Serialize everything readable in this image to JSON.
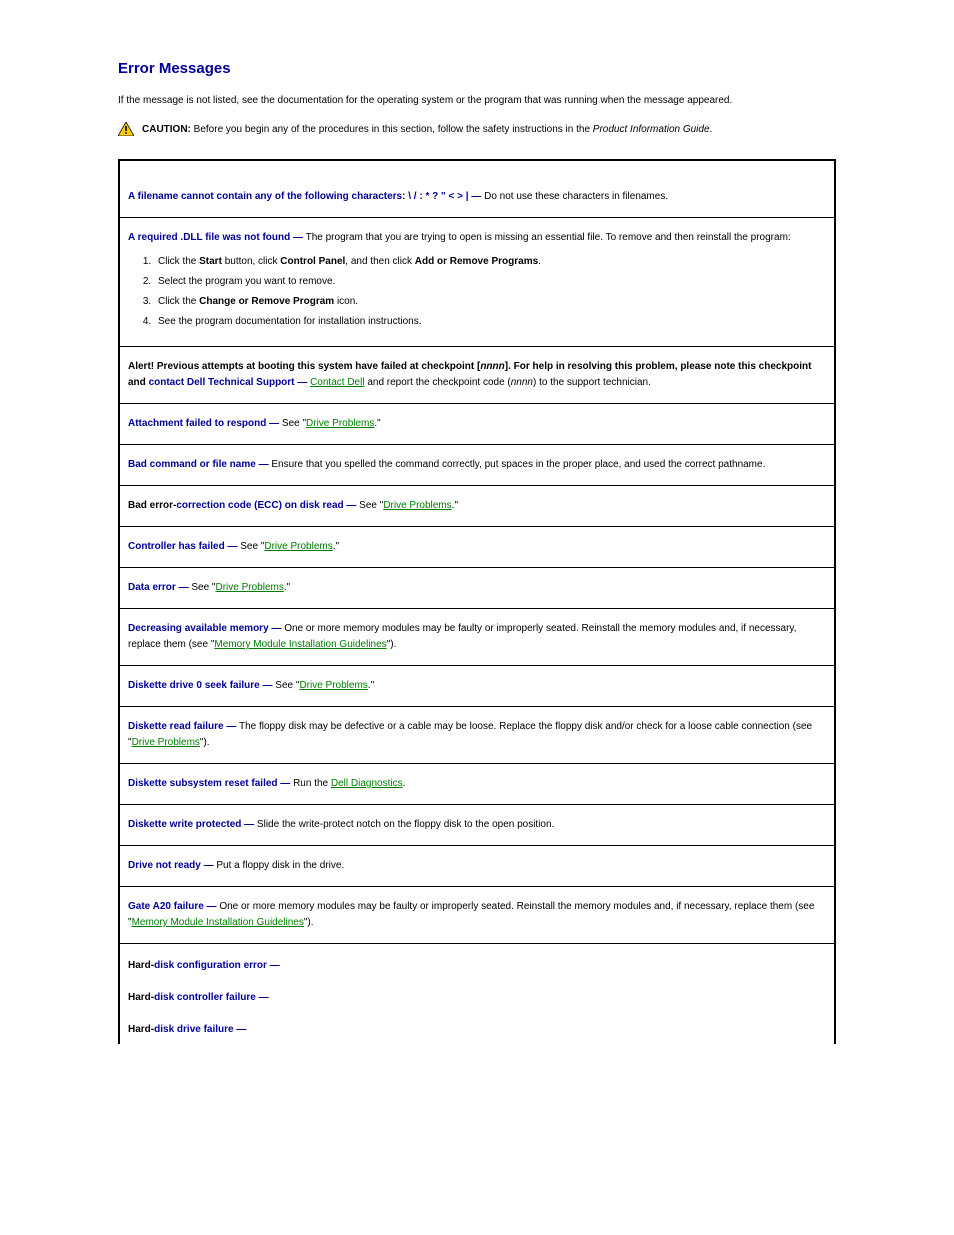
{
  "heading": "Error Messages",
  "intro": "If the message is not listed, see the documentation for the operating system or the program that was running when the message appeared.",
  "caution": {
    "label": "CAUTION:",
    "text_before": "Before you begin any of the procedures in this section, follow the safety instructions in the ",
    "ital": "Product Information Guide",
    "text_after": "."
  },
  "rows": [
    {
      "title": "A filename cannot contain any of the following characters: \\ / : * ? \" < > |  —",
      "body": "  Do not use these characters in filenames."
    },
    {
      "title": "A required .DLL file was not found  —",
      "body": "  The program that you are trying to open is missing an essential file. To remove and then reinstall the program:",
      "list": [
        {
          "text": "Click the ",
          "b1": "Start",
          "t2": " button, click ",
          "b2": "Control Panel",
          "t3": ", and then click ",
          "b3": "Add or Remove Programs",
          "t4": "."
        },
        {
          "text": "Select the program you want to remove."
        },
        {
          "text": "Click the ",
          "b1": "Change or Remove Program",
          "t2": " icon."
        },
        {
          "text": "See the program documentation for installation instructions."
        }
      ]
    },
    {
      "prefixBlack": "Alert! Previous attempts at booting this system have failed at checkpoint [",
      "prefixBlack2": "nnnn",
      "prefixBlack3": "]. For help in resolving this problem, please note this checkpoint and ",
      "title": "contact Dell Technical Support  —",
      "link": "Contact Dell",
      "body2": " and report the checkpoint code (",
      "ital": "nnnn",
      "body3": ") to the support technician."
    },
    {
      "title": "Attachment failed to respond  —",
      "body": "  See \"",
      "link": "Drive Problems",
      "body2": ".\""
    },
    {
      "title": "Bad command or file name  —",
      "body": "  Ensure that you spelled the command correctly, put spaces in the proper place, and used the correct pathname."
    },
    {
      "prefixBlack": "Bad error-",
      "title": "correction code (ECC) on disk read  —",
      "body": "  See \"",
      "link": "Drive Problems",
      "body2": ".\""
    },
    {
      "title": "Controller has failed  —",
      "body": "  See \"",
      "link": "Drive Problems",
      "body2": ".\""
    },
    {
      "title": "Data error  —",
      "body": "  See \"",
      "link": "Drive Problems",
      "body2": ".\""
    },
    {
      "title": "Decreasing available memory  —",
      "body": "  One or more memory modules may be faulty or improperly seated. Reinstall the memory modules and, if necessary, replace them (see \"",
      "link": "Memory Module Installation Guidelines",
      "body2": "\")."
    },
    {
      "title": "Diskette drive 0 seek failure  —",
      "body": "  See \"",
      "link": "Drive Problems",
      "body2": ".\""
    },
    {
      "title": "Diskette read failure  —",
      "body": "  The floppy disk may be defective or a cable may be loose. Replace the floppy disk and/or check for a loose cable connection (see \"",
      "link": "Drive Problems",
      "body2": "\")."
    },
    {
      "title": "Diskette subsystem reset failed  —",
      "body": "  Run the ",
      "link": "Dell Diagnostics",
      "body2": "."
    },
    {
      "title": "Diskette write protected  —",
      "body": "  Slide the write-protect notch on the floppy disk to the open position."
    },
    {
      "title": "Drive not ready  —",
      "body": "  Put a floppy disk in the drive."
    },
    {
      "title": "Gate A20 failure  —",
      "body": "  One or more memory modules may be faulty or improperly seated. Reinstall the memory modules and, if necessary, replace them (see \"",
      "link": "Memory Module Installation Guidelines",
      "body2": "\")."
    },
    {
      "prefixBlack": "Hard-",
      "title": "disk configuration error  —",
      "noborder": true
    },
    {
      "prefixBlack": "Hard-",
      "title": "disk controller failure  —",
      "noborder": true
    },
    {
      "prefixBlack": "Hard-",
      "title": "disk drive failure  —",
      "noborder": true
    }
  ]
}
